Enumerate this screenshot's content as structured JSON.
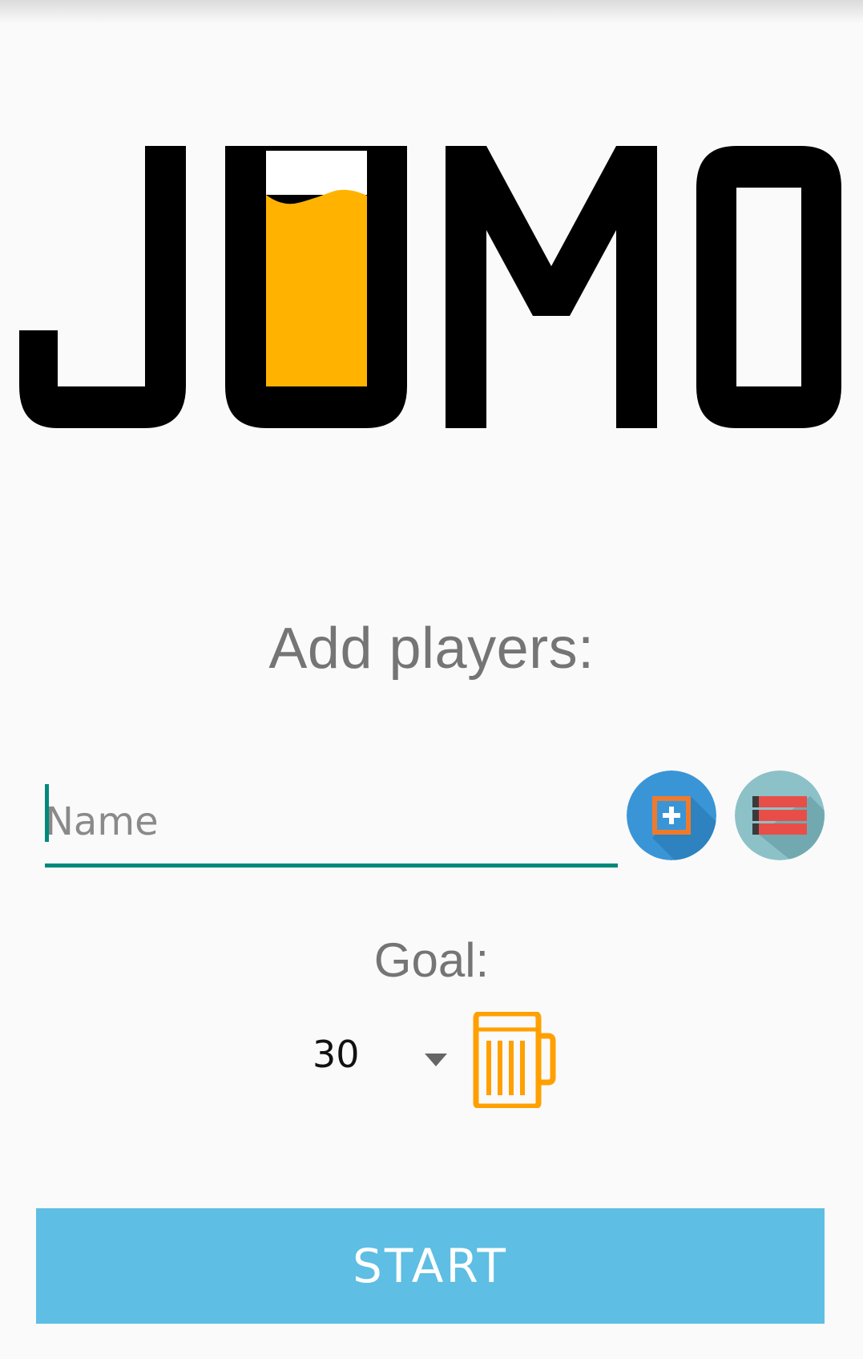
{
  "logo": {
    "text": "JUMO",
    "colors": {
      "letters": "#000000",
      "beer": "#ffb300",
      "foam": "#ffffff"
    }
  },
  "players": {
    "title": "Add players:",
    "name_placeholder": "Name",
    "name_value": "",
    "add_icon": "add-player-icon",
    "list_icon": "player-list-icon"
  },
  "goal": {
    "label": "Goal:",
    "selected_value": "30",
    "icon": "beer-mug-icon"
  },
  "actions": {
    "start_label": "START"
  },
  "colors": {
    "accent": "#00897b",
    "start_button": "#5ebee3",
    "add_button": "#3a95d6",
    "list_button": "#8cc1c8",
    "beer_icon": "#ffa000"
  }
}
